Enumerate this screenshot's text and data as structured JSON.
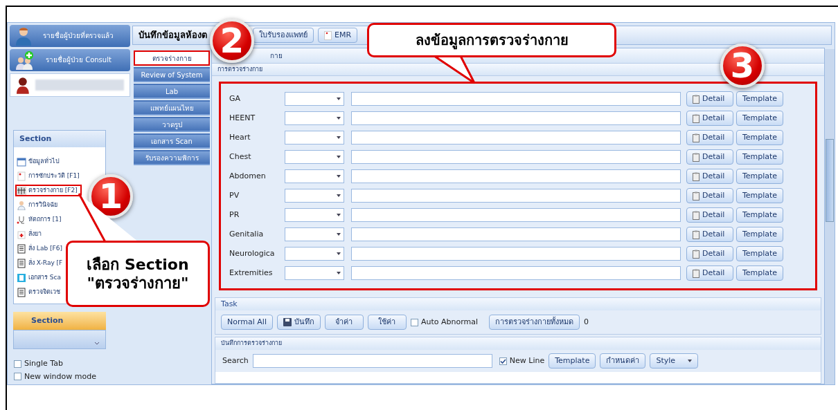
{
  "patient_buttons": [
    {
      "label": "รายชื่อผู้ป่วยที่ตรวจแล้ว",
      "kind": "doctor"
    },
    {
      "label": "รายชื่อผู้ป่วย Consult",
      "kind": "consult"
    }
  ],
  "section_panel": {
    "title": "Section",
    "items": [
      {
        "label": "ข้อมูลทั่วไป",
        "kind": "calendar",
        "highlighted": false
      },
      {
        "label": "การซักประวัติ [F1]",
        "kind": "note",
        "highlighted": false
      },
      {
        "label": "ตรวจร่างกาย  [F2]",
        "kind": "body",
        "highlighted": true
      },
      {
        "label": "การวินิจฉัย",
        "kind": "doctor",
        "highlighted": false
      },
      {
        "label": "หัตถการ [1]",
        "kind": "stethoscope",
        "highlighted": false
      },
      {
        "label": "สั่งยา",
        "kind": "medicine",
        "highlighted": false
      },
      {
        "label": "สั่ง Lab  [F6]",
        "kind": "sheet",
        "highlighted": false
      },
      {
        "label": "สั่ง X-Ray  [F",
        "kind": "sheet",
        "highlighted": false
      },
      {
        "label": "เอกสาร Sca",
        "kind": "scan",
        "highlighted": false
      },
      {
        "label": "ตรวจจิตเวช",
        "kind": "sheet",
        "highlighted": false
      }
    ],
    "bar_label": "Section"
  },
  "options": [
    {
      "label": "Single Tab",
      "checked": false
    },
    {
      "label": "New window mode",
      "checked": false
    }
  ],
  "toolbar": {
    "title": "บันทึกข้อมูลห้องต",
    "buttons": [
      {
        "label": "ใบรับรองแพทย์",
        "icon": false
      },
      {
        "label": "EMR",
        "icon": true
      }
    ]
  },
  "side_tabs": [
    {
      "label": "ตรวจร่างกาย",
      "selected": true
    },
    {
      "label": "Review of System",
      "selected": false
    },
    {
      "label": "Lab",
      "selected": false
    },
    {
      "label": "แพทย์แผนไทย",
      "selected": false
    },
    {
      "label": "วาดรูป",
      "selected": false
    },
    {
      "label": "เอกสาร Scan",
      "selected": false
    },
    {
      "label": "รับรองความพิการ",
      "selected": false
    }
  ],
  "panel_title": "กาย",
  "group": {
    "title": "การตรวจร่างกาย",
    "highlighted": true,
    "rows": [
      {
        "label": "GA",
        "detail": "Detail",
        "template": "Template"
      },
      {
        "label": "HEENT",
        "detail": "Detail",
        "template": "Template"
      },
      {
        "label": "Heart",
        "detail": "Detail",
        "template": "Template"
      },
      {
        "label": "Chest",
        "detail": "Detail",
        "template": "Template"
      },
      {
        "label": "Abdomen",
        "detail": "Detail",
        "template": "Template"
      },
      {
        "label": "PV",
        "detail": "Detail",
        "template": "Template"
      },
      {
        "label": "PR",
        "detail": "Detail",
        "template": "Template"
      },
      {
        "label": "Genitalia",
        "detail": "Detail",
        "template": "Template"
      },
      {
        "label": "Neurologica",
        "detail": "Detail",
        "template": "Template"
      },
      {
        "label": "Extremities",
        "detail": "Detail",
        "template": "Template"
      }
    ]
  },
  "task": {
    "title": "Task",
    "buttons": [
      {
        "label": "Normal All",
        "icon": false
      },
      {
        "label": "บันทึก",
        "icon": true
      },
      {
        "label": "จำค่า",
        "icon": false
      },
      {
        "label": "ใช้ค่า",
        "icon": false
      }
    ],
    "auto_abnormal": {
      "label": "Auto Abnormal",
      "checked": false
    },
    "all_button": "การตรวจร่างกายทั้งหมด",
    "count": "0"
  },
  "record": {
    "title": "บันทึกการตรวจร่างกาย",
    "search_label": "Search",
    "new_line": {
      "label": "New Line",
      "checked": true
    },
    "buttons": [
      "Template",
      "กำหนดค่า"
    ],
    "style": "Style"
  },
  "annotations": [
    {
      "kind": "badge",
      "text": "1"
    },
    {
      "kind": "badge",
      "text": "2"
    },
    {
      "kind": "badge",
      "text": "3"
    },
    {
      "kind": "callout",
      "lines": [
        "เลือก Section",
        "\"ตรวจร่างกาย\""
      ]
    },
    {
      "kind": "callout",
      "lines": [
        "ลงข้อมูลการตรวจร่างกาย"
      ]
    }
  ]
}
